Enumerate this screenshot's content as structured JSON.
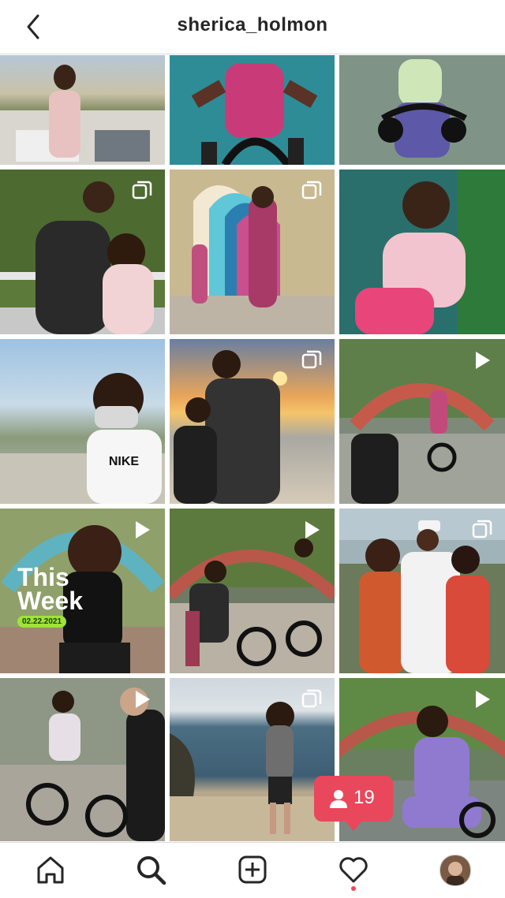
{
  "header": {
    "username": "sherica_holmon"
  },
  "tiles": [
    {
      "overlay": "none"
    },
    {
      "overlay": "none"
    },
    {
      "overlay": "none"
    },
    {
      "overlay": "carousel"
    },
    {
      "overlay": "carousel"
    },
    {
      "overlay": "none"
    },
    {
      "overlay": "none"
    },
    {
      "overlay": "carousel"
    },
    {
      "overlay": "video"
    },
    {
      "overlay": "video",
      "text": "This Week",
      "date": "02.22.2021"
    },
    {
      "overlay": "video"
    },
    {
      "overlay": "carousel"
    },
    {
      "overlay": "video"
    },
    {
      "overlay": "carousel"
    },
    {
      "overlay": "video"
    }
  ],
  "tile_text": {
    "this_week_1": "This",
    "this_week_2": "Week",
    "date": "02.22.2021",
    "shirt": "NIKE"
  },
  "notification": {
    "count": "19"
  },
  "colors": {
    "accent": "#e9475b",
    "text": "#262626",
    "dot": "#ed4956"
  },
  "nav": {
    "icons": [
      "home-icon",
      "search-icon",
      "new-post-icon",
      "activity-heart-icon",
      "profile-avatar"
    ]
  }
}
